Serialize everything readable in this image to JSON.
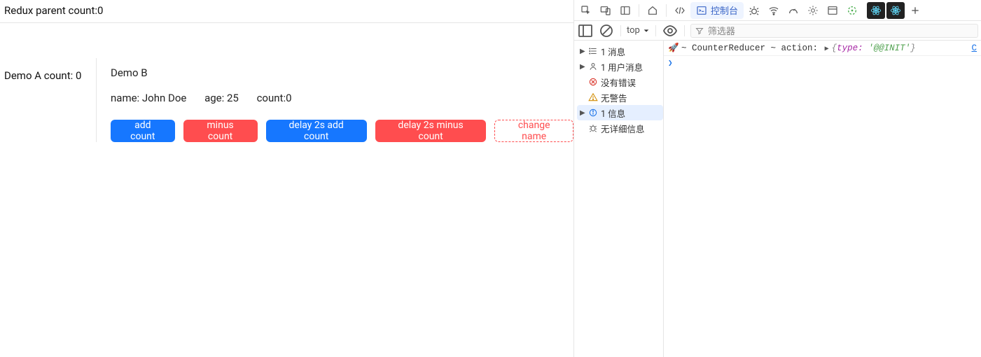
{
  "header": {
    "title": "Redux parent count:0"
  },
  "demoA": {
    "label": "Demo A count: 0"
  },
  "demoB": {
    "title": "Demo B",
    "name_label": "name: John Doe",
    "age_label": "age: 25",
    "count_label": "count:0",
    "buttons": {
      "add": "add count",
      "minus": "minus count",
      "delay_add": "delay 2s add count",
      "delay_minus": "delay 2s minus count",
      "change_name": "change name"
    }
  },
  "devtools": {
    "tabs": {
      "console": "控制台"
    },
    "console_toolbar": {
      "context": "top",
      "filter_placeholder": "筛选器"
    },
    "sidebar": {
      "messages": "1 消息",
      "user_messages": "1 用户消息",
      "no_errors": "没有错误",
      "no_warnings": "无警告",
      "info": "1 信息",
      "no_verbose": "无详细信息"
    },
    "log": {
      "prefix": " ~ CounterReducer ~ action:",
      "obj_key": "type:",
      "obj_val": "'@@INIT'",
      "source": "C"
    }
  }
}
